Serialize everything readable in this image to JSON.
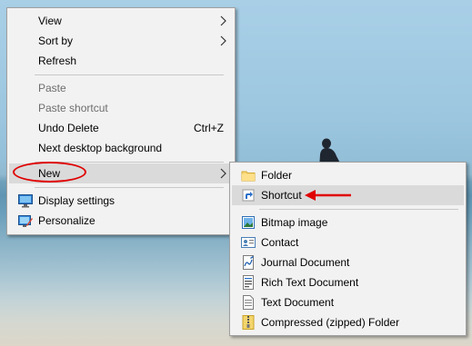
{
  "context_menu": {
    "items": [
      {
        "label": "View",
        "submenu": true
      },
      {
        "label": "Sort by",
        "submenu": true
      },
      {
        "label": "Refresh"
      },
      {
        "label": "Paste",
        "disabled": true
      },
      {
        "label": "Paste shortcut",
        "disabled": true
      },
      {
        "label": "Undo Delete",
        "shortcut": "Ctrl+Z"
      },
      {
        "label": "Next desktop background"
      },
      {
        "label": "New",
        "submenu": true,
        "highlighted": true
      },
      {
        "label": "Display settings",
        "icon": "display-icon"
      },
      {
        "label": "Personalize",
        "icon": "personalize-icon"
      }
    ]
  },
  "new_submenu": {
    "items": [
      {
        "label": "Folder",
        "icon": "folder-icon"
      },
      {
        "label": "Shortcut",
        "icon": "shortcut-icon",
        "highlighted": true
      },
      {
        "label": "Bitmap image",
        "icon": "bitmap-icon"
      },
      {
        "label": "Contact",
        "icon": "contact-icon"
      },
      {
        "label": "Journal Document",
        "icon": "journal-icon"
      },
      {
        "label": "Rich Text Document",
        "icon": "rich-text-icon"
      },
      {
        "label": "Text Document",
        "icon": "text-document-icon"
      },
      {
        "label": "Compressed (zipped) Folder",
        "icon": "zip-folder-icon"
      }
    ]
  },
  "annotations": {
    "ellipse_color": "#e00000",
    "arrow_color": "#e00000"
  }
}
